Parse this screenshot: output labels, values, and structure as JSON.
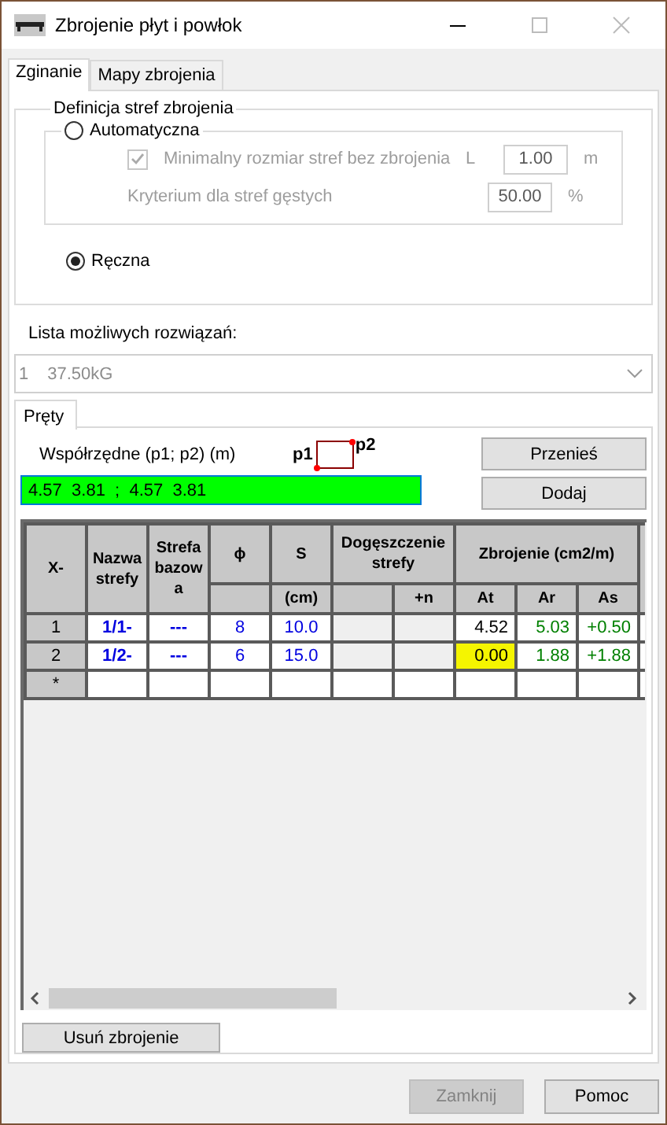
{
  "window": {
    "title": "Zbrojenie płyt i powłok"
  },
  "tabs": [
    {
      "label": "Zginanie",
      "selected": true
    },
    {
      "label": "Mapy zbrojenia",
      "selected": false
    }
  ],
  "zones_group": {
    "title": "Definicja stref zbrojenia",
    "automatic": {
      "label": "Automatyczna",
      "selected": false
    },
    "min_size": {
      "label": "Minimalny rozmiar stref bez zbrojenia",
      "checked": true,
      "disabled": true,
      "symbol": "L",
      "value": "1.00",
      "unit": "m"
    },
    "criterion": {
      "label": "Kryterium dla stref gęstych",
      "disabled": true,
      "value": "50.00",
      "unit": "%"
    },
    "manual": {
      "label": "Ręczna",
      "selected": true
    }
  },
  "solutions": {
    "label": "Lista możliwych rozwiązań:",
    "number": "1",
    "value": "37.50kG"
  },
  "inner_tabs": [
    {
      "label": "Pręty",
      "selected": true
    }
  ],
  "coordinates": {
    "label": "Współrzędne (p1; p2) (m)",
    "p1": "p1",
    "p2": "p2",
    "value": "4.57  3.81  ;  4.57  3.81"
  },
  "side_buttons": [
    "Przenieś",
    "Dodaj"
  ],
  "table": {
    "columns": [
      "X-",
      "Nazwa strefy",
      "Strefa bazowa",
      "ϕ",
      "S",
      "Dogęszczenie strefy",
      "Zbrojenie (cm2/m)"
    ],
    "subheaders": {
      "spacing": "(cm)",
      "densify": "+n",
      "at": "At",
      "ar": "Ar",
      "as": "As"
    },
    "rows": [
      {
        "label": "1",
        "name": "1/1-",
        "base": "---",
        "diameter": "8",
        "spacing": "10.0",
        "at": "4.52",
        "ar": "5.03",
        "as": "+0.50",
        "at_flagged": false
      },
      {
        "label": "2",
        "name": "1/2-",
        "base": "---",
        "diameter": "6",
        "spacing": "15.0",
        "at": "0.00",
        "ar": "1.88",
        "as": "+1.88",
        "at_flagged": true
      }
    ],
    "new_row_label": "*"
  },
  "delete_button": "Usuń zbrojenie",
  "footer_buttons": [
    {
      "label": "Zamknij",
      "disabled": true
    },
    {
      "label": "Pomoc",
      "disabled": false
    }
  ]
}
